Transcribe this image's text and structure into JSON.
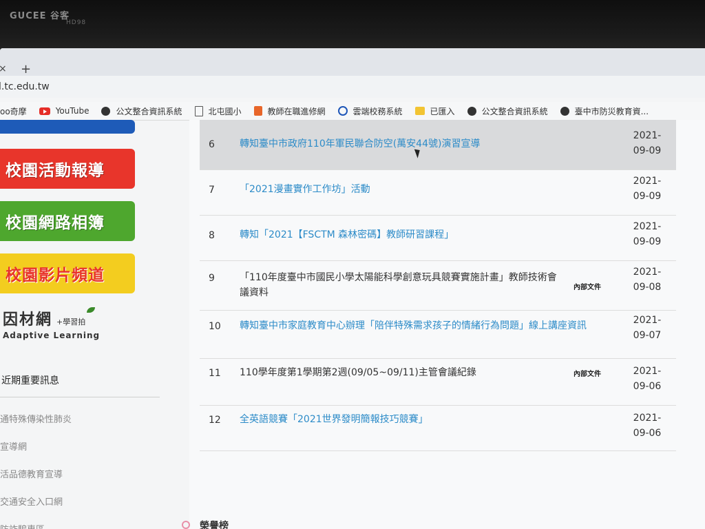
{
  "bezel": {
    "brand": "GUCEE 谷客",
    "model": "HD98"
  },
  "browser": {
    "tab_close": "×",
    "tab_new": "+",
    "url": "l.tc.edu.tw",
    "bookmarks": [
      {
        "label": "oo奇摩",
        "icon": "none"
      },
      {
        "label": "YouTube",
        "icon": "youtube-icon"
      },
      {
        "label": "公文整合資訊系統",
        "icon": "globe-icon"
      },
      {
        "label": "北屯國小",
        "icon": "page-icon"
      },
      {
        "label": "教師在職進修網",
        "icon": "orange-doc-icon"
      },
      {
        "label": "雲端校務系統",
        "icon": "circle-logo-icon"
      },
      {
        "label": "已匯入",
        "icon": "folder-icon"
      },
      {
        "label": "公文整合資訊系統",
        "icon": "globe-icon"
      },
      {
        "label": "臺中市防災教育資...",
        "icon": "globe-icon"
      }
    ]
  },
  "sidebar": {
    "banners": [
      "校園活動報導",
      "校園網路相簿",
      "校園影片頻道"
    ],
    "adaptive": {
      "main": "因材網",
      "sub": "+學習拍",
      "en": "Adaptive Learning"
    },
    "section_title": "近期重要訊息",
    "links": [
      "通特殊傳染性肺炎",
      "宣導網",
      "活品德教育宣導",
      "交通安全入口網",
      "防詐騙專區"
    ]
  },
  "announcements": [
    {
      "num": "6",
      "title": "轉知臺中市政府110年軍民聯合防空(萬安44號)演習宣導",
      "badge": "",
      "date": "2021-09-09",
      "link": true
    },
    {
      "num": "7",
      "title": "「2021漫畫實作工作坊」活動",
      "badge": "",
      "date": "2021-09-09",
      "link": true
    },
    {
      "num": "8",
      "title": "轉知「2021【FSCTM 森林密碼】教師研習課程」",
      "badge": "",
      "date": "2021-09-09",
      "link": true
    },
    {
      "num": "9",
      "title": "「110年度臺中市國民小學太陽能科學創意玩具競賽實施計畫」教師技術會議資料",
      "badge": "內部文件",
      "date": "2021-09-08",
      "link": false
    },
    {
      "num": "10",
      "title": "轉知臺中市家庭教育中心辦理「陪伴特殊需求孩子的情緒行為問題」線上講座資訊",
      "badge": "",
      "date": "2021-09-07",
      "link": true
    },
    {
      "num": "11",
      "title": "110學年度第1學期第2週(09/05~09/11)主管會議紀錄",
      "badge": "內部文件",
      "date": "2021-09-06",
      "link": false
    },
    {
      "num": "12",
      "title": "全英語競賽「2021世界發明簡報技巧競賽」",
      "badge": "",
      "date": "2021-09-06",
      "link": true
    }
  ],
  "honor": {
    "title": "榮譽榜"
  }
}
